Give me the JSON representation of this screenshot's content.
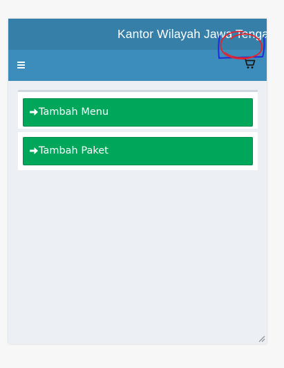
{
  "header": {
    "title": "Kantor Wilayah Jawa Tengah"
  },
  "navbar": {
    "menu_icon": "hamburger-icon",
    "cart_icon": "shopping-cart-icon"
  },
  "main": {
    "buttons": [
      {
        "label": "Tambah Menu",
        "icon": "arrow-right-icon"
      },
      {
        "label": "Tambah Paket",
        "icon": "arrow-right-icon"
      }
    ]
  },
  "colors": {
    "title_bar": "#367fa9",
    "nav_bar": "#3c8dbc",
    "content_bg": "#ecf0f5",
    "button": "#00a65a",
    "annotation_red": "#e8202a",
    "annotation_blue": "#1d2bd8"
  }
}
